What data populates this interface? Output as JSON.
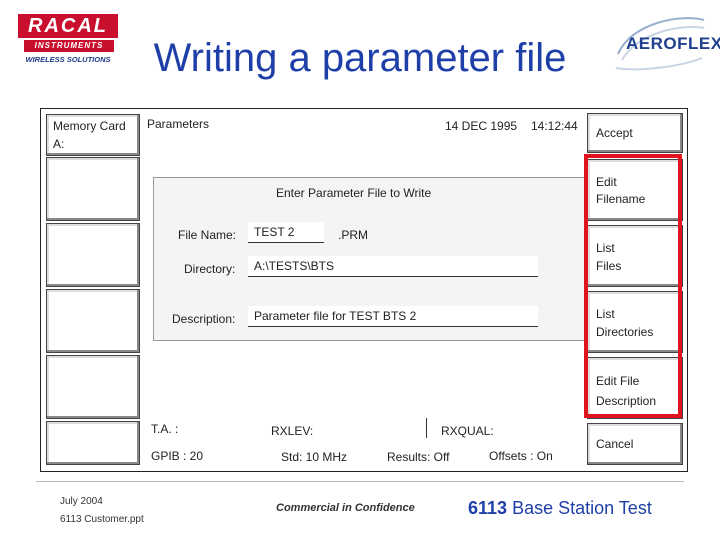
{
  "logos": {
    "racal": {
      "word": "RACAL",
      "instruments": "INSTRUMENTS",
      "tagline": "WIRELESS SOLUTIONS"
    },
    "aeroflex": {
      "word": "AEROFLEX"
    }
  },
  "slide": {
    "title": "Writing a parameter file"
  },
  "screen": {
    "memory_card": {
      "label": "Memory Card",
      "drive": "A:"
    },
    "parameters_label": "Parameters",
    "date": "14  DEC 1995",
    "time": "14:12:44",
    "dialog": {
      "heading": "Enter  Parameter File to Write",
      "file_name": {
        "label": "File Name:",
        "value": "TEST 2",
        "extension": ".PRM"
      },
      "directory": {
        "label": "Directory:",
        "value": "A:\\TESTS\\BTS"
      },
      "description": {
        "label": "Description:",
        "value": "Parameter file for TEST BTS 2"
      }
    },
    "softkeys": [
      {
        "line1": "Accept",
        "line2": ""
      },
      {
        "line1": "Edit",
        "line2": "Filename"
      },
      {
        "line1": "List",
        "line2": "Files"
      },
      {
        "line1": "List",
        "line2": "Directories"
      },
      {
        "line1": "Edit File",
        "line2": "Description"
      },
      {
        "line1": "Cancel",
        "line2": ""
      }
    ],
    "status": {
      "ta": "T.A. :",
      "rxlev": "RXLEV:",
      "rxqual": "RXQUAL:",
      "gpib": "GPIB :  20",
      "std": "Std:  10 MHz",
      "results": "Results: Off",
      "offsets": "Offsets : On"
    }
  },
  "footer": {
    "date": "July 2004",
    "file": "6113 Customer.ppt",
    "confidence": "Commercial in Confidence",
    "product_number": "6113",
    "product_text": " Base Station Test"
  },
  "colors": {
    "title_blue": "#1f3fa8",
    "highlight_red": "#e0141e",
    "racal_red": "#c8102e"
  }
}
